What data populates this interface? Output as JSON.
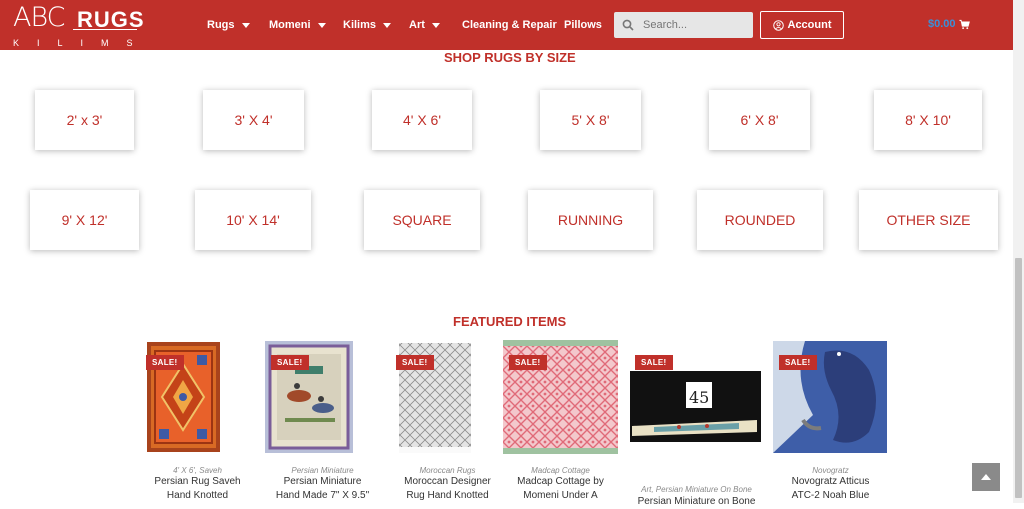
{
  "header": {
    "logo_mark": "ABC",
    "logo_rugs": "RUGS",
    "logo_kilims": "KILIMS",
    "nav": [
      {
        "label": "Rugs",
        "has_dropdown": true
      },
      {
        "label": "Momeni",
        "has_dropdown": true
      },
      {
        "label": "Kilims",
        "has_dropdown": true
      },
      {
        "label": "Art",
        "has_dropdown": true
      },
      {
        "label": "Cleaning & Repair",
        "has_dropdown": false
      },
      {
        "label": "Pillows",
        "has_dropdown": false
      }
    ],
    "search_placeholder": "Search...",
    "account_label": "Account",
    "cart_total": "$0.00"
  },
  "sizes": {
    "title": "SHOP RUGS BY SIZE",
    "items": [
      "2' x 3'",
      "3' X 4'",
      "4' X 6'",
      "5' X 8'",
      "6' X 8'",
      "8' X 10'",
      "9' X 12'",
      "10' X 14'",
      "SQUARE",
      "RUNNING",
      "ROUNDED",
      "OTHER SIZE"
    ]
  },
  "featured": {
    "title": "FEATURED ITEMS",
    "sale_label": "SALE!",
    "products": [
      {
        "category": "4' X 6', Saveh",
        "name_line1": "Persian Rug Saveh",
        "name_line2": "Hand Knotted"
      },
      {
        "category": "Persian Miniature",
        "name_line1": "Persian Miniature",
        "name_line2": "Hand Made 7\" X 9.5\""
      },
      {
        "category": "Moroccan Rugs",
        "name_line1": "Moroccan Designer",
        "name_line2": "Rug Hand Knotted"
      },
      {
        "category": "Madcap Cottage",
        "name_line1": "Madcap Cottage by",
        "name_line2": "Momeni Under A"
      },
      {
        "category": "Art, Persian Miniature On Bone",
        "name_line1": "Persian Miniature on Bone",
        "name_line2": ""
      },
      {
        "category": "Novogratz",
        "name_line1": "Novogratz Atticus",
        "name_line2": "ATC-2 Noah Blue"
      }
    ]
  },
  "bone_tag": "45",
  "colors": {
    "brand_red": "#c0302a",
    "cart_blue": "#3b8fd8"
  }
}
